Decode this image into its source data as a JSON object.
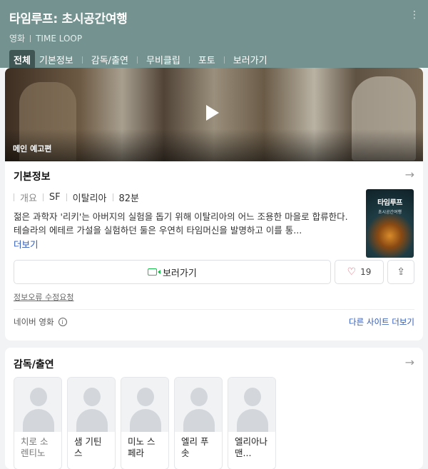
{
  "header": {
    "title": "타임루프: 초시공간여행",
    "category": "영화",
    "english_title": "TIME LOOP",
    "more_icon": "more-vertical-icon",
    "tabs": [
      {
        "label": "전체",
        "active": true
      },
      {
        "label": "기본정보",
        "active": false
      },
      {
        "label": "감독/출연",
        "active": false
      },
      {
        "label": "무비클립",
        "active": false
      },
      {
        "label": "포토",
        "active": false
      },
      {
        "label": "보러가기",
        "active": false
      }
    ]
  },
  "video": {
    "caption": "메인 예고편"
  },
  "basic_info": {
    "heading": "기본정보",
    "meta_label": "개요",
    "genre": "SF",
    "country": "이탈리아",
    "runtime": "82분",
    "synopsis": "젊은 과학자 '리키'는 아버지의 실험을 돕기 위해 이탈리아의 어느 조용한 마을로 합류한다. 테슬라의 에테르 가설을 실험하던 둘은 우연히 타임머신을 발명하고 이를 통...",
    "more_label": "더보기",
    "poster": {
      "title": "타임루프",
      "subtitle": "초시공간여행"
    }
  },
  "actions": {
    "watch_label": "보러가기",
    "like_count": "19"
  },
  "report_label": "정보오류 수정요청",
  "footer": {
    "source": "네이버 영화",
    "other_sites": "다른 사이트 더보기"
  },
  "cast_section": {
    "heading": "감독/출연",
    "people": [
      {
        "name": "치로 소렌티노",
        "muted": true
      },
      {
        "name": "샘 기틴스",
        "muted": false
      },
      {
        "name": "미노 스페라",
        "muted": false
      },
      {
        "name": "엘리 푸솟",
        "muted": false
      },
      {
        "name": "엘리아나 맨...",
        "muted": false
      }
    ]
  },
  "colors": {
    "header_bg": "#74928f",
    "active_tab": "#3f5654",
    "link": "#2a57b8",
    "watch_icon": "#19c04b",
    "heart": "#e34a5a"
  }
}
